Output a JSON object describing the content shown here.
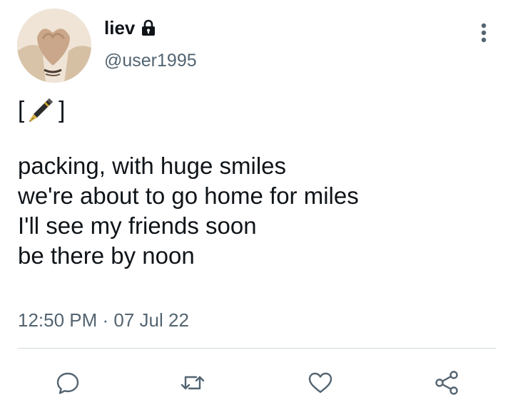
{
  "user": {
    "display_name": "liev",
    "handle": "@user1995"
  },
  "tweet": {
    "tag_open": "[",
    "tag_close": "]",
    "lines": [
      "packing, with huge smiles",
      "we're about to go home for miles",
      "I'll see my friends soon",
      "be there by noon"
    ],
    "timestamp": "12:50 PM · 07 Jul 22"
  },
  "icons": {
    "lock": "lock-icon",
    "pen": "fountain-pen-emoji",
    "more": "more-vertical-icon",
    "reply": "reply-icon",
    "retweet": "retweet-icon",
    "like": "heart-icon",
    "share": "share-icon"
  },
  "colors": {
    "text_primary": "#0f1419",
    "text_secondary": "#536471",
    "icon_gray": "#536471",
    "divider": "#cfd9de"
  }
}
